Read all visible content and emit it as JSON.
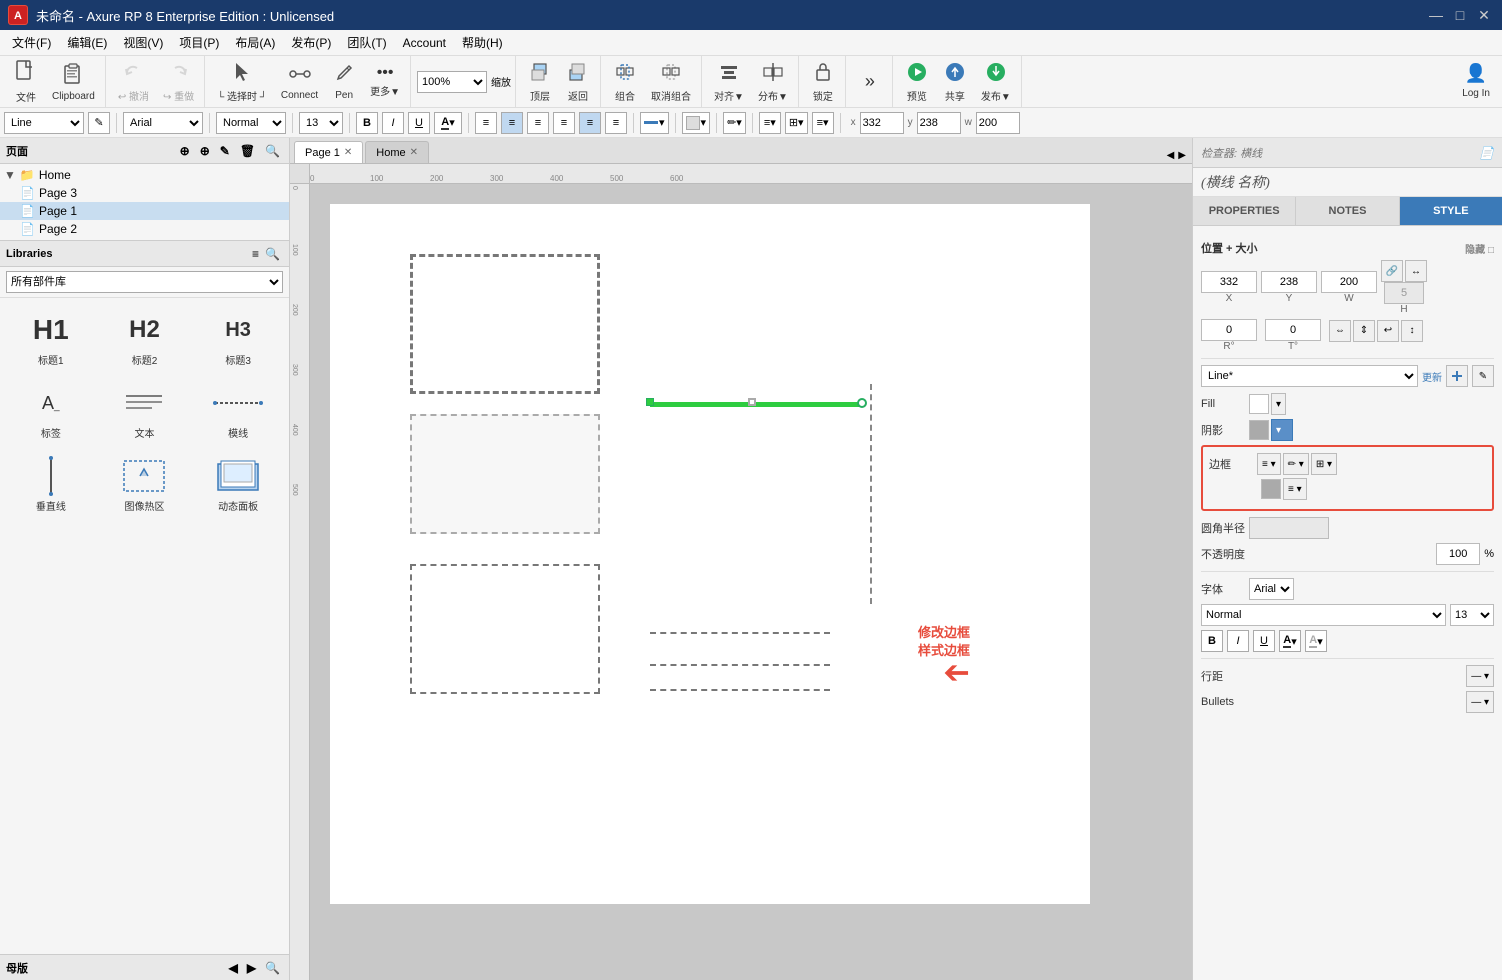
{
  "titlebar": {
    "logo_text": "A",
    "title": "未命名 - Axure RP 8 Enterprise Edition : Unlicensed",
    "minimize": "—",
    "maximize": "□",
    "close": "✕"
  },
  "menubar": {
    "items": [
      "文件(F)",
      "编辑(E)",
      "视图(V)",
      "项目(P)",
      "布局(A)",
      "发布(P)",
      "团队(T)",
      "Account",
      "帮助(H)"
    ]
  },
  "toolbar": {
    "groups": [
      {
        "buttons": [
          {
            "id": "file-btn",
            "icon": "📄",
            "label": "文件"
          },
          {
            "id": "clipboard-btn",
            "icon": "📋",
            "label": "Clipboard"
          }
        ]
      },
      {
        "buttons": [
          {
            "id": "undo-btn",
            "icon": "↩",
            "label": "撤消",
            "sub": true
          },
          {
            "id": "redo-btn",
            "icon": "↪",
            "label": "重做",
            "sub": true
          }
        ]
      },
      {
        "buttons": [
          {
            "id": "select-btn",
            "icon": "↖",
            "label": "选择时"
          },
          {
            "id": "connect-btn",
            "icon": "⛓",
            "label": "Connect"
          },
          {
            "id": "pen-btn",
            "icon": "✏",
            "label": "Pen"
          },
          {
            "id": "more-btn",
            "icon": "•••",
            "label": "更多▼"
          }
        ]
      },
      {
        "buttons": [
          {
            "id": "zoom-label",
            "icon": "",
            "label": "100%▼",
            "is_zoom": true
          }
        ]
      },
      {
        "buttons": [
          {
            "id": "top-btn",
            "icon": "⬆",
            "label": "顶层"
          },
          {
            "id": "back-btn",
            "icon": "⬇",
            "label": "返回"
          }
        ]
      },
      {
        "buttons": [
          {
            "id": "group-btn",
            "icon": "⊞",
            "label": "组合"
          },
          {
            "id": "ungroup-btn",
            "icon": "⊟",
            "label": "取消组合"
          }
        ]
      },
      {
        "buttons": [
          {
            "id": "align-btn",
            "icon": "≡",
            "label": "对齐▼"
          },
          {
            "id": "dist-btn",
            "icon": "⠿",
            "label": "分布▼"
          }
        ]
      },
      {
        "buttons": [
          {
            "id": "lock-btn",
            "icon": "🔒",
            "label": "锁定"
          }
        ]
      },
      {
        "buttons": [
          {
            "id": "more2-btn",
            "icon": "»",
            "label": ""
          }
        ]
      },
      {
        "buttons": [
          {
            "id": "preview-btn",
            "icon": "▶",
            "label": "预览"
          },
          {
            "id": "share-btn",
            "icon": "↗",
            "label": "共享"
          },
          {
            "id": "publish-btn",
            "icon": "⬇",
            "label": "发布▼"
          }
        ]
      },
      {
        "buttons": [
          {
            "id": "login-btn",
            "icon": "👤",
            "label": "Log In"
          }
        ]
      }
    ]
  },
  "format_toolbar": {
    "widget_type": "Line",
    "edit_icon": "✎",
    "font_family": "Arial",
    "font_style": "Normal",
    "font_size": "13",
    "bold": "B",
    "italic": "I",
    "underline": "U",
    "text_color_icon": "A",
    "align_icons": [
      "≡",
      "≡",
      "≡",
      "≡",
      "≡",
      "≡"
    ],
    "line_color_icon": "─",
    "fill_icon": "▣",
    "pen_icon": "✏",
    "border_icons": [
      "≡",
      "⊞",
      "≡"
    ],
    "x_label": "x",
    "x_value": "332",
    "y_label": "y",
    "y_value": "238",
    "w_label": "w",
    "w_value": "200"
  },
  "pages_panel": {
    "title": "页面",
    "icons": [
      "⊕",
      "⊕",
      "✎",
      "🗑",
      "🔍"
    ],
    "pages": [
      {
        "id": "home",
        "name": "Home",
        "level": 0,
        "icon": "📁"
      },
      {
        "id": "page3",
        "name": "Page 3",
        "level": 1,
        "icon": "📄"
      },
      {
        "id": "page1",
        "name": "Page 1",
        "level": 1,
        "icon": "📄",
        "selected": true
      },
      {
        "id": "page2",
        "name": "Page 2",
        "level": 1,
        "icon": "📄"
      }
    ]
  },
  "libraries_panel": {
    "title": "Libraries",
    "icons": [
      "≡",
      "🔍"
    ],
    "selector_label": "所有部件库",
    "items": [
      {
        "id": "h1",
        "label": "标题1",
        "type": "h1"
      },
      {
        "id": "h2",
        "label": "标题2",
        "type": "h2"
      },
      {
        "id": "h3",
        "label": "标题3",
        "type": "h3"
      },
      {
        "id": "label",
        "label": "标签",
        "type": "label"
      },
      {
        "id": "text",
        "label": "文本",
        "type": "text"
      },
      {
        "id": "line",
        "label": "模线",
        "type": "line"
      },
      {
        "id": "vline",
        "label": "垂直线",
        "type": "vline"
      },
      {
        "id": "hotspot",
        "label": "图像热区",
        "type": "hotspot"
      },
      {
        "id": "dynamic",
        "label": "动态面板",
        "type": "dynamic"
      }
    ]
  },
  "masters_panel": {
    "title": "母版",
    "icons": [
      "⊕",
      "⊕",
      "✎",
      "🗑",
      "🔍"
    ]
  },
  "canvas": {
    "tabs": [
      {
        "id": "page1",
        "label": "Page 1",
        "active": true,
        "closable": true
      },
      {
        "id": "home",
        "label": "Home",
        "active": false,
        "closable": true
      }
    ]
  },
  "right_panel": {
    "title": "(横线 名称)",
    "docs_icon": "📄",
    "tabs": [
      {
        "id": "properties",
        "label": "PROPERTIES",
        "active": false
      },
      {
        "id": "notes",
        "label": "NOTES",
        "active": false
      },
      {
        "id": "style",
        "label": "STYLE",
        "active": true
      }
    ],
    "style": {
      "position_section": "位置 + 大小",
      "hide_label": "隐藏",
      "x_value": "332",
      "y_value": "238",
      "w_value": "200",
      "h_value": "5",
      "r_value": "0",
      "t_value": "0",
      "style_name": "Line*",
      "update_label": "更新",
      "create_label": "创建",
      "fill_label": "Fill",
      "shadow_label": "阴影",
      "border_label": "边框",
      "corner_label": "圆角半径",
      "opacity_label": "不透明度",
      "opacity_value": "100",
      "opacity_unit": "%",
      "font_label": "字体",
      "font_family": "Arial",
      "font_style": "Normal",
      "font_size": "13",
      "bold": "B",
      "italic": "I",
      "underline": "U",
      "line_spacing_label": "行距",
      "bullets_label": "Bullets"
    }
  },
  "annotation": {
    "text_line1": "修改边框",
    "text_line2": "样式边框",
    "arrow": "➔"
  }
}
